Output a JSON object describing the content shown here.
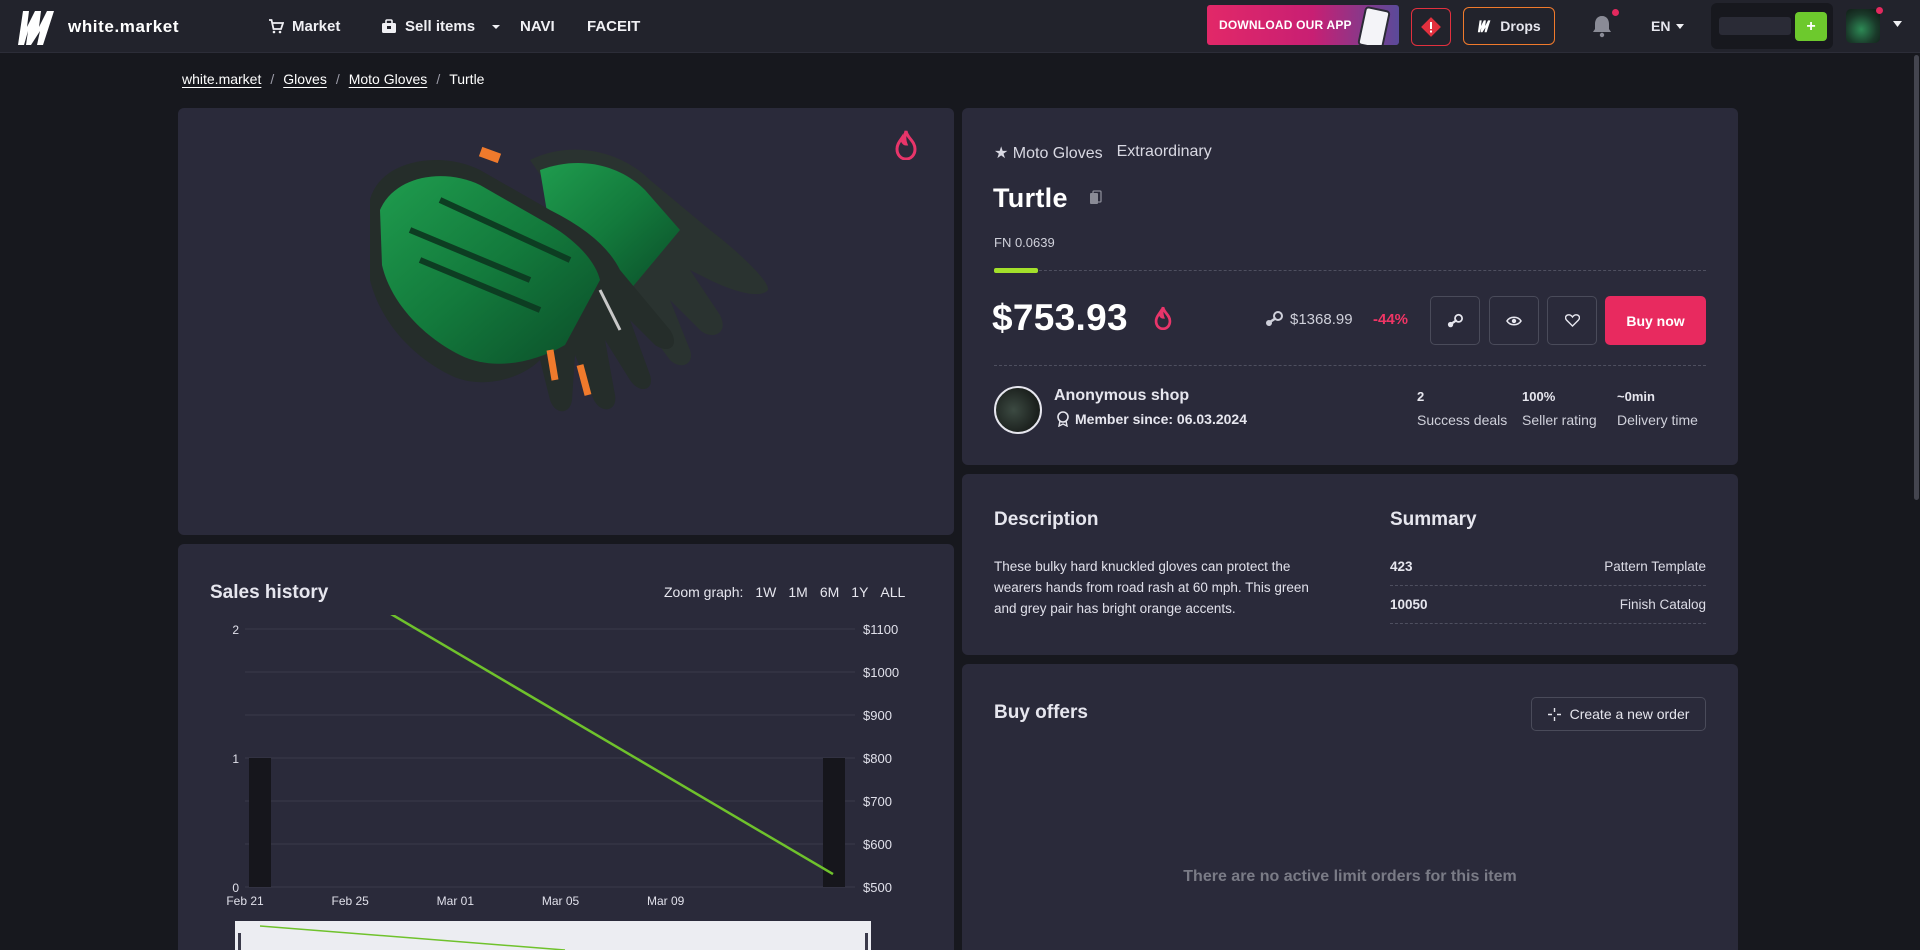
{
  "header": {
    "logo_text": "white.market",
    "nav": [
      {
        "label": "Market",
        "icon": "cart-icon"
      },
      {
        "label": "Sell items",
        "icon": "briefcase-icon"
      },
      {
        "label": "NAVI"
      },
      {
        "label": "FACEIT"
      }
    ],
    "download_banner": "DOWNLOAD OUR APP",
    "drops_label": "Drops",
    "language": "EN",
    "wallet_add": "+"
  },
  "breadcrumb": [
    "white.market",
    "Gloves",
    "Moto Gloves",
    "Turtle"
  ],
  "item": {
    "category": "★ Moto Gloves",
    "rarity": "Extraordinary",
    "name": "Turtle",
    "float_label": "FN 0.0639",
    "float_value": 0.0639,
    "price": "$753.93",
    "steam_price": "$1368.99",
    "discount": "-44%",
    "buy_label": "Buy now"
  },
  "seller": {
    "name": "Anonymous shop",
    "member_since": "Member since: 06.03.2024",
    "stats": [
      {
        "value": "2",
        "label": "Success deals"
      },
      {
        "value": "100%",
        "label": "Seller rating"
      },
      {
        "value": "~0min",
        "label": "Delivery time"
      }
    ]
  },
  "description": {
    "title": "Description",
    "text": "These bulky hard knuckled gloves can protect the wearers hands from road rash at 60 mph. This green and grey pair has bright orange accents."
  },
  "summary": {
    "title": "Summary",
    "rows": [
      {
        "value": "423",
        "key": "Pattern Template"
      },
      {
        "value": "10050",
        "key": "Finish Catalog"
      }
    ]
  },
  "sales_history": {
    "title": "Sales history",
    "zoom_label": "Zoom graph:",
    "zoom_options": [
      "1W",
      "1M",
      "6M",
      "1Y",
      "ALL"
    ]
  },
  "buy_offers": {
    "title": "Buy offers",
    "create_label": "Create a new order",
    "empty_text": "There are no active limit orders for this item"
  },
  "chart_data": {
    "type": "line",
    "x_ticks": [
      "Feb 21",
      "Feb 25",
      "Mar 01",
      "Mar 05",
      "Mar 09"
    ],
    "y_left_ticks": [
      0,
      1,
      2
    ],
    "y_right_ticks": [
      "$500",
      "$600",
      "$700",
      "$800",
      "$900",
      "$1000",
      "$1100"
    ],
    "price_series": {
      "x": [
        "Feb 21",
        "Mar 12"
      ],
      "values": [
        1310,
        530
      ]
    },
    "volume_series": {
      "x": [
        "Feb 21",
        "Mar 12"
      ],
      "values": [
        1,
        1
      ]
    },
    "y_right_range": [
      500,
      1100
    ],
    "y_left_range": [
      0,
      2
    ],
    "colors": {
      "line": "#6fc22c",
      "bars": "#16161c",
      "grid": "#3a3a4a"
    }
  }
}
